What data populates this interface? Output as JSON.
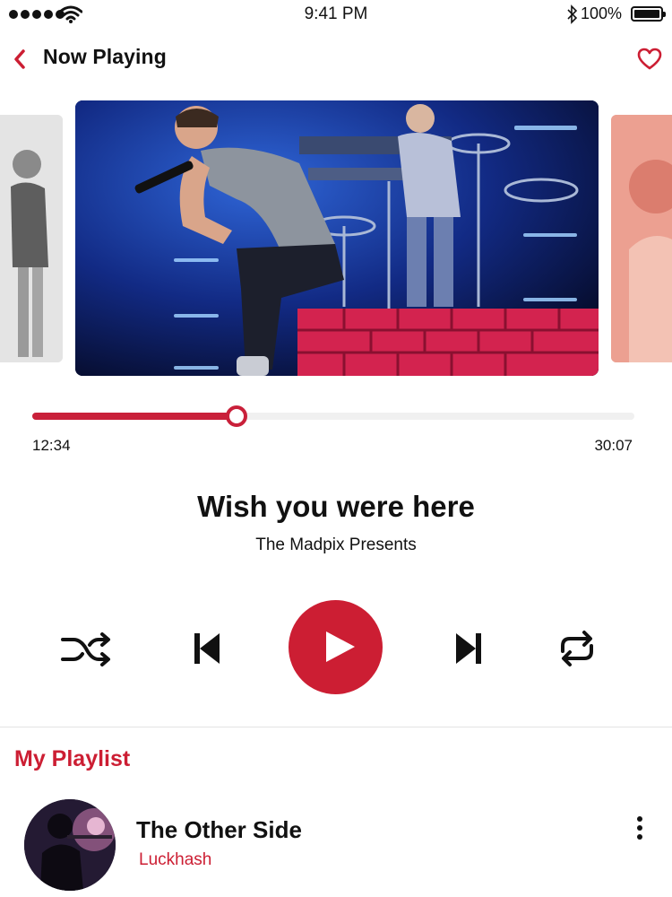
{
  "status_bar": {
    "time": "9:41 PM",
    "battery": "100%",
    "icons": [
      "signal-dots-icon",
      "wifi-icon",
      "bluetooth-icon",
      "battery-icon"
    ]
  },
  "header": {
    "title": "Now Playing",
    "back_icon": "chevron-left-icon",
    "favorite_icon": "heart-outline-icon"
  },
  "player": {
    "current_time": "12:34",
    "total_time": "30:07",
    "progress": 0.34,
    "song_title": "Wish you were here",
    "artist": "The Madpix Presents",
    "controls": [
      "shuffle-icon",
      "skip-previous-icon",
      "play-icon",
      "skip-next-icon",
      "repeat-icon"
    ]
  },
  "playlist": {
    "heading": "My Playlist",
    "items": [
      {
        "title": "The Other Side",
        "artist": "Luckhash"
      }
    ]
  },
  "colors": {
    "accent": "#cc1e33",
    "text": "#111111",
    "track": "#f0f0f0"
  }
}
